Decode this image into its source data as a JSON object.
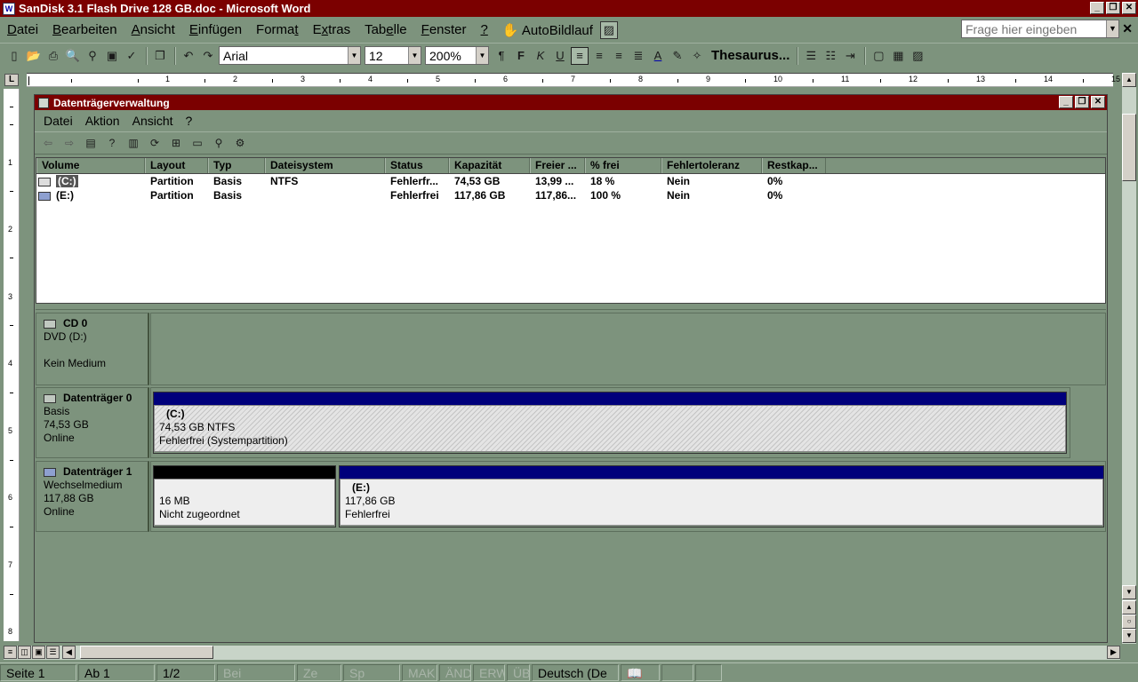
{
  "window": {
    "title": "SanDisk 3.1 Flash Drive 128 GB.doc - Microsoft Word",
    "app_icon": "W"
  },
  "menubar": {
    "items": [
      {
        "u": "D",
        "rest": "atei"
      },
      {
        "u": "B",
        "rest": "earbeiten"
      },
      {
        "u": "A",
        "rest": "nsicht"
      },
      {
        "u": "E",
        "rest": "infügen"
      },
      {
        "pre": "Forma",
        "u": "t",
        "rest": ""
      },
      {
        "pre": "E",
        "u": "x",
        "rest": "tras"
      },
      {
        "pre": "Tab",
        "u": "e",
        "rest": "lle"
      },
      {
        "u": "F",
        "rest": "enster"
      },
      {
        "u": "?",
        "rest": ""
      }
    ],
    "autobildlauf": "AutoBildlauf",
    "help_placeholder": "Frage hier eingeben"
  },
  "toolbar": {
    "font": "Arial",
    "size": "12",
    "zoom": "200%",
    "bold": "F",
    "italic": "K",
    "underline": "U",
    "thesaurus": "Thesaurus..."
  },
  "ruler": {
    "numbers": [
      "1",
      "2",
      "3",
      "4",
      "5",
      "6",
      "7",
      "8",
      "9",
      "10",
      "11",
      "12",
      "13",
      "14",
      "15"
    ],
    "vnumbers": [
      "1",
      "2",
      "3",
      "4",
      "5",
      "6",
      "7",
      "8"
    ],
    "corner": "L"
  },
  "dm": {
    "title": "Datenträgerverwaltung",
    "menu": [
      "Datei",
      "Aktion",
      "Ansicht",
      "?"
    ],
    "columns": [
      "Volume",
      "Layout",
      "Typ",
      "Dateisystem",
      "Status",
      "Kapazität",
      "Freier ...",
      "% frei",
      "Fehlertoleranz",
      "Restkap..."
    ],
    "rows": [
      {
        "volume": "(C:)",
        "layout": "Partition",
        "typ": "Basis",
        "fs": "NTFS",
        "status": "Fehlerfr...",
        "cap": "74,53 GB",
        "free": "13,99 ...",
        "pct": "18 %",
        "ft": "Nein",
        "rest": "0%"
      },
      {
        "volume": "(E:)",
        "layout": "Partition",
        "typ": "Basis",
        "fs": "",
        "status": "Fehlerfrei",
        "cap": "117,86 GB",
        "free": "117,86...",
        "pct": "100 %",
        "ft": "Nein",
        "rest": "0%"
      }
    ],
    "disks": {
      "cd0": {
        "name": "CD 0",
        "l1": "DVD (D:)",
        "l2": "",
        "l3": "Kein Medium"
      },
      "d0": {
        "name": "Datenträger 0",
        "l1": "Basis",
        "l2": "74,53 GB",
        "l3": "Online",
        "part": {
          "name": "(C:)",
          "size": "74,53 GB NTFS",
          "status": "Fehlerfrei (Systempartition)"
        }
      },
      "d1": {
        "name": "Datenträger 1",
        "l1": "Wechselmedium",
        "l2": "117,88 GB",
        "l3": "Online",
        "unalloc": {
          "size": "16 MB",
          "status": "Nicht zugeordnet"
        },
        "part": {
          "name": "(E:)",
          "size": "117,86 GB",
          "status": "Fehlerfrei"
        }
      }
    }
  },
  "statusbar": {
    "page": "Seite 1",
    "section": "Ab 1",
    "pages": "1/2",
    "at": "Bei",
    "line": "Ze",
    "col": "Sp",
    "mak": "MAK",
    "aend": "ÄND",
    "erw": "ERW",
    "ueb": "ÜB",
    "lang": "Deutsch (De"
  },
  "colors": {
    "titlebar": "#7b0000",
    "chrome": "#7d937d",
    "primary_partition": "#00007b",
    "unallocated": "#000000"
  }
}
